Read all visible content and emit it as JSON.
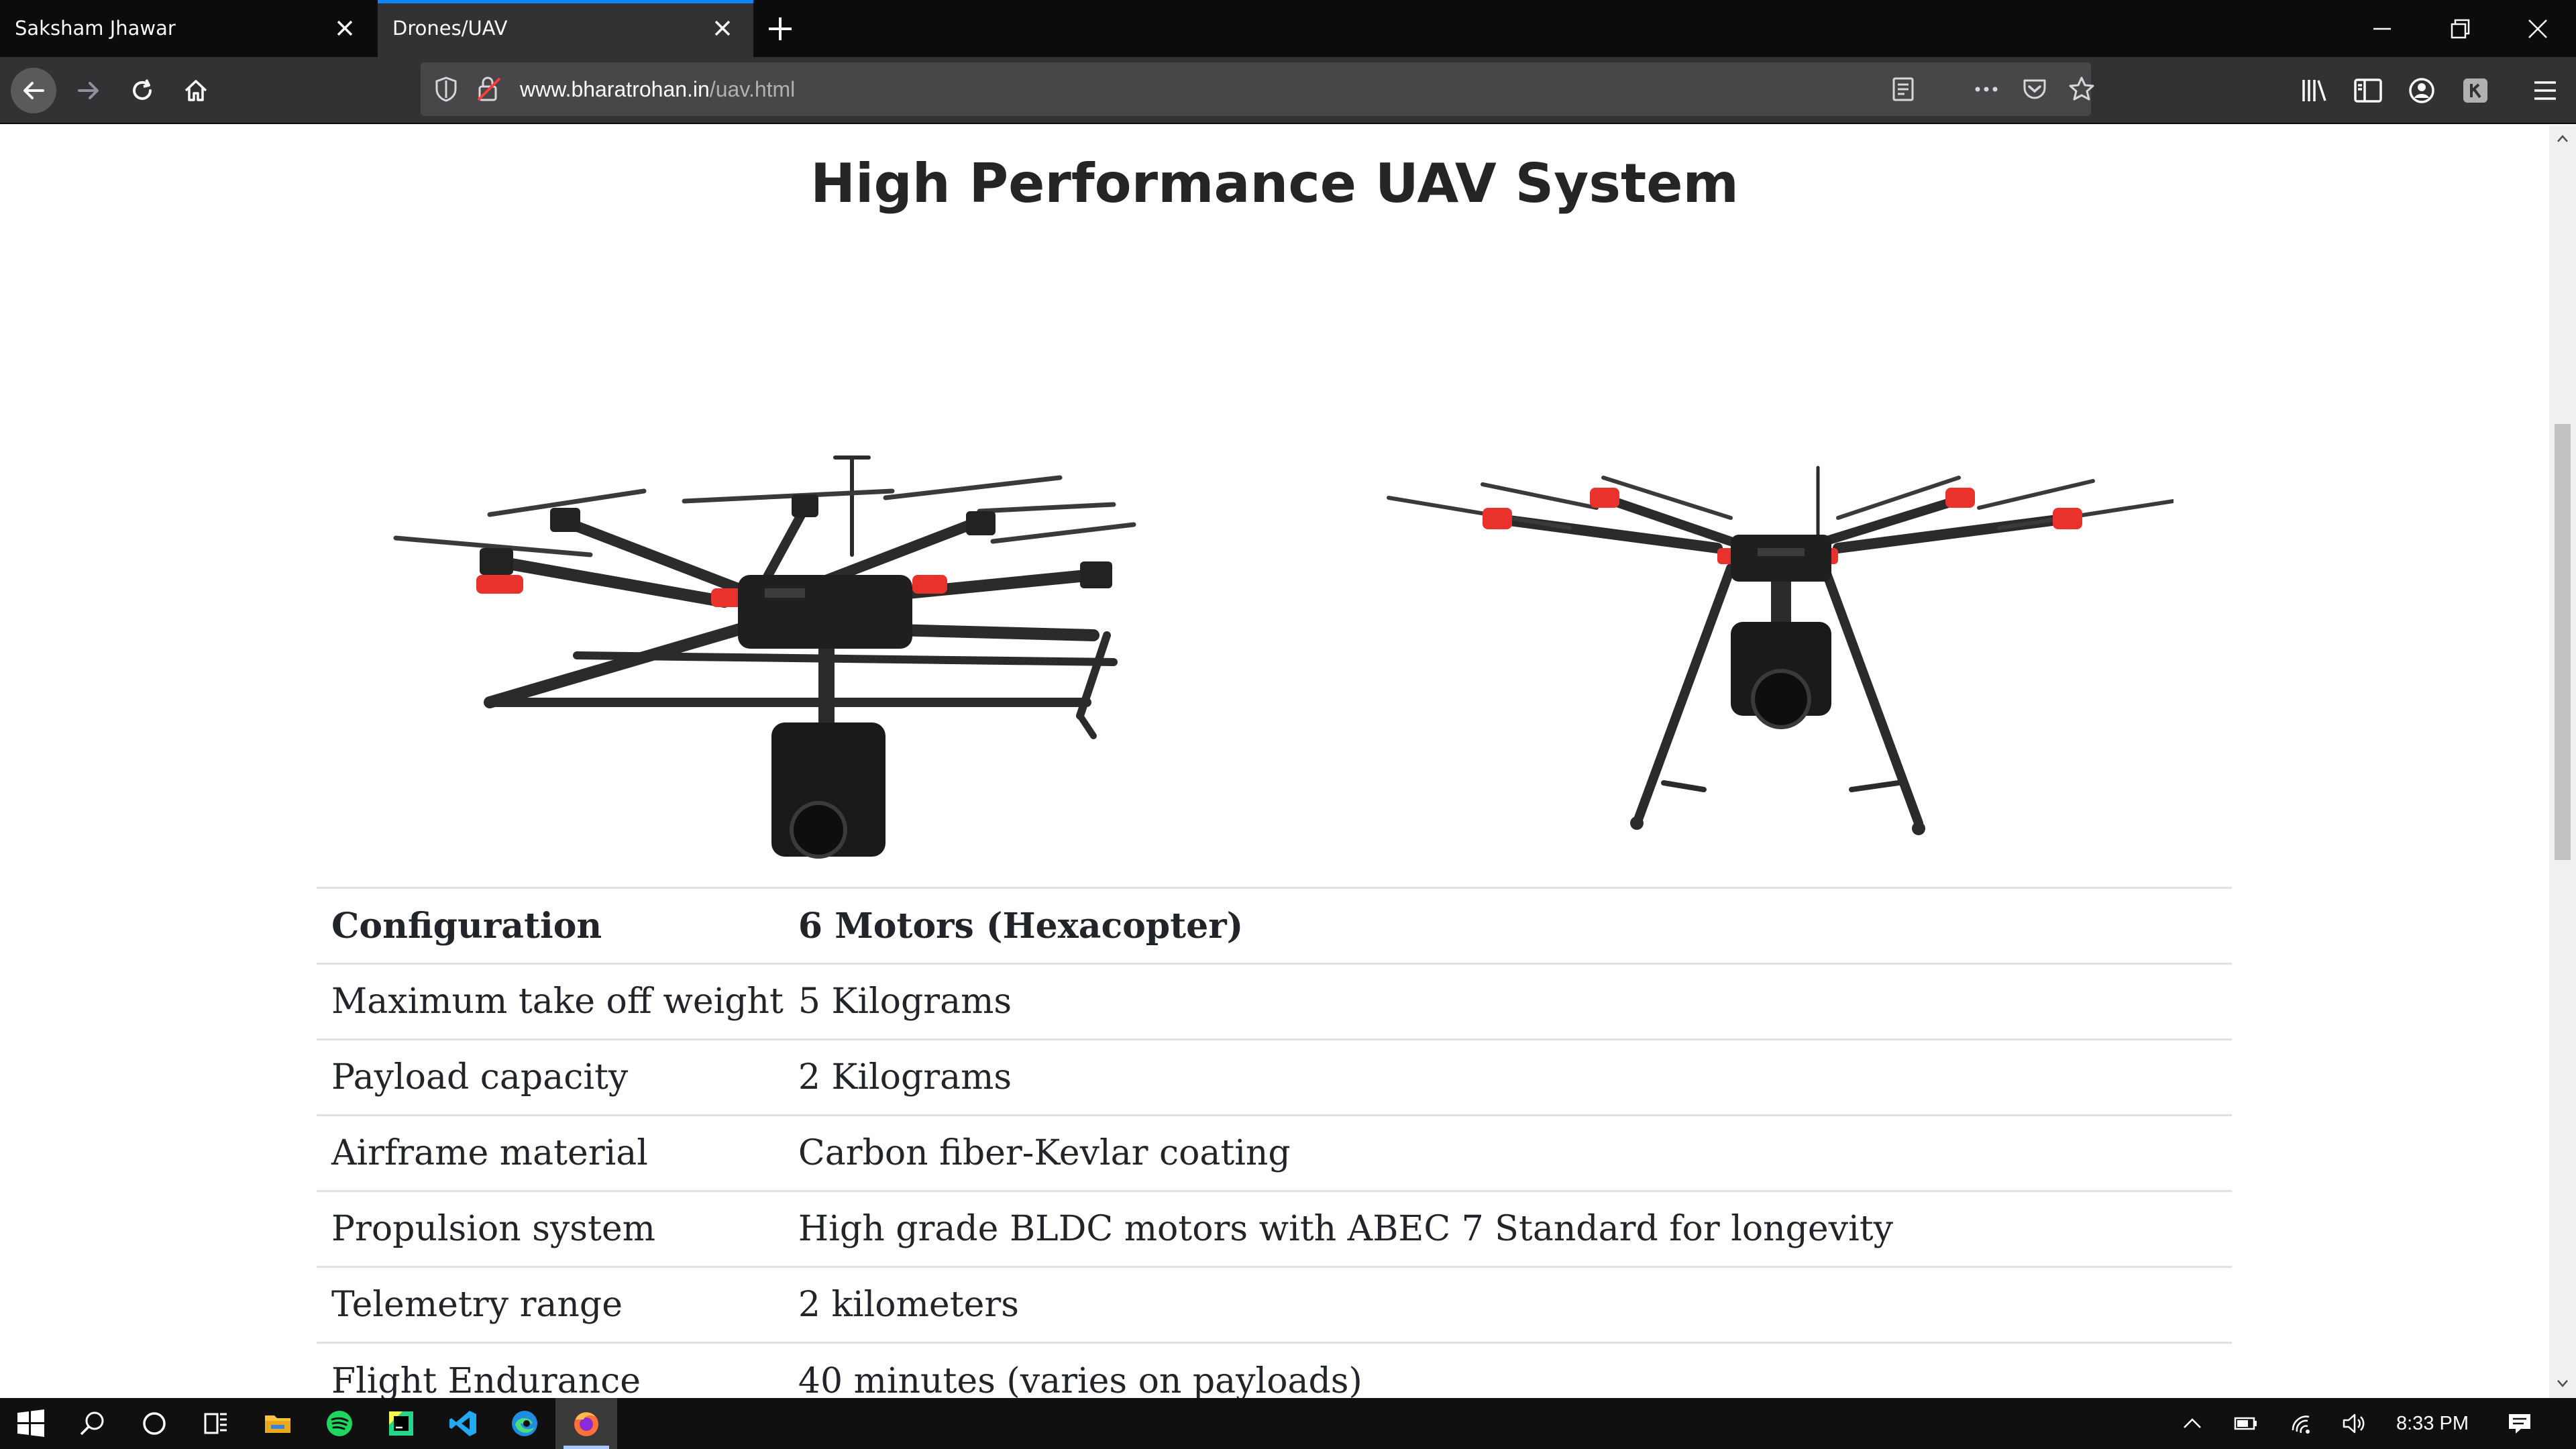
{
  "browser": {
    "tabs": [
      {
        "title": "Saksham Jhawar",
        "active": false
      },
      {
        "title": "Drones/UAV",
        "active": true
      }
    ],
    "url_domain": "www.bharatrohan.in",
    "url_path": "/uav.html"
  },
  "page": {
    "title": "High Performance UAV System",
    "images": [
      {
        "alt": "Hexacopter drone angled view"
      },
      {
        "alt": "Hexacopter drone front view"
      }
    ],
    "specs": {
      "header": {
        "label": "Configuration",
        "value": "6 Motors (Hexacopter)"
      },
      "rows": [
        {
          "label": "Maximum take off weight",
          "value": "5 Kilograms"
        },
        {
          "label": "Payload capacity",
          "value": "2 Kilograms"
        },
        {
          "label": "Airframe material",
          "value": "Carbon fiber-Kevlar coating"
        },
        {
          "label": "Propulsion system",
          "value": "High grade BLDC motors with ABEC 7 Standard for longevity"
        },
        {
          "label": "Telemetry range",
          "value": "2 kilometers"
        },
        {
          "label": "Flight Endurance",
          "value": "40 minutes (varies on payloads)"
        }
      ]
    }
  },
  "taskbar": {
    "apps": [
      "start-icon",
      "search-icon",
      "cortana-icon",
      "task-view-icon",
      "file-explorer-icon",
      "spotify-icon",
      "pycharm-icon",
      "vscode-icon",
      "edge-icon",
      "firefox-icon"
    ],
    "clock": "8:33 PM"
  },
  "colors": {
    "tab_accent": "#0a84ff",
    "chrome_dark": "#0c0c0d",
    "toolbar": "#323234",
    "drone_red": "#e8322b"
  }
}
